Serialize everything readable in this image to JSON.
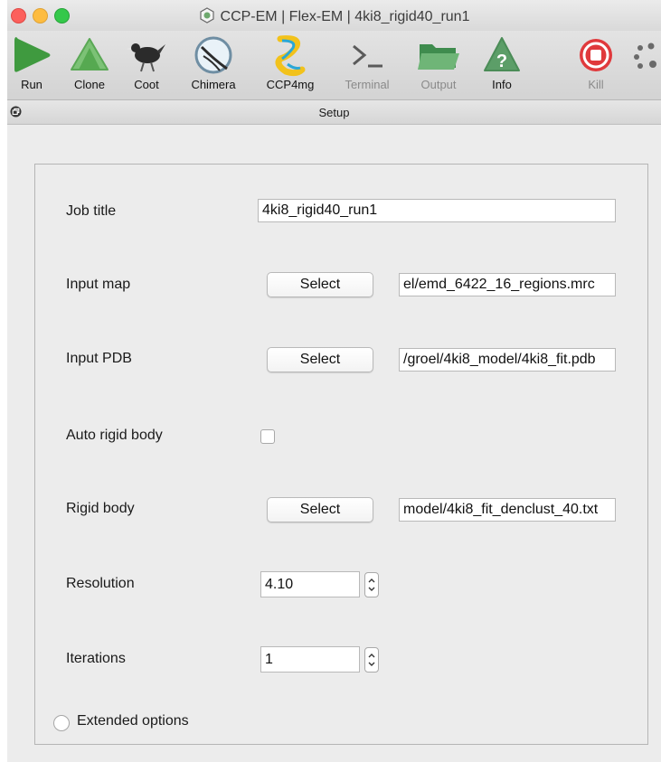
{
  "window": {
    "title": "CCP-EM | Flex-EM | 4ki8_rigid40_run1"
  },
  "toolbar": {
    "items": [
      {
        "label": "Run",
        "icon": "run-play-icon",
        "enabled": true
      },
      {
        "label": "Clone",
        "icon": "clone-icon",
        "enabled": true
      },
      {
        "label": "Coot",
        "icon": "coot-bird-icon",
        "enabled": true
      },
      {
        "label": "Chimera",
        "icon": "chimera-icon",
        "enabled": true
      },
      {
        "label": "CCP4mg",
        "icon": "ccp4mg-icon",
        "enabled": true
      },
      {
        "label": "Terminal",
        "icon": "terminal-icon",
        "enabled": false
      },
      {
        "label": "Output",
        "icon": "folder-icon",
        "enabled": false
      },
      {
        "label": "Info",
        "icon": "info-question-icon",
        "enabled": true
      },
      {
        "label": "Kill",
        "icon": "kill-stop-icon",
        "enabled": false
      }
    ]
  },
  "setup": {
    "caption": "Setup"
  },
  "form": {
    "job_title": {
      "label": "Job title",
      "value": "4ki8_rigid40_run1"
    },
    "input_map": {
      "label": "Input map",
      "button": "Select",
      "value": "el/emd_6422_16_regions.mrc"
    },
    "input_pdb": {
      "label": "Input PDB",
      "button": "Select",
      "value": "/groel/4ki8_model/4ki8_fit.pdb"
    },
    "auto_rigid_body": {
      "label": "Auto rigid body",
      "checked": false
    },
    "rigid_body": {
      "label": "Rigid body",
      "button": "Select",
      "value": "model/4ki8_fit_denclust_40.txt"
    },
    "resolution": {
      "label": "Resolution",
      "value": "4.10"
    },
    "iterations": {
      "label": "Iterations",
      "value": "1"
    },
    "extended_options": {
      "label": "Extended options",
      "selected": false
    }
  },
  "colors": {
    "run_green": "#3f9a3f",
    "clone_green": "#64b55f",
    "output_green": "#4e9d5a",
    "info_green": "#5c9e68",
    "kill_red": "#e0393c"
  }
}
